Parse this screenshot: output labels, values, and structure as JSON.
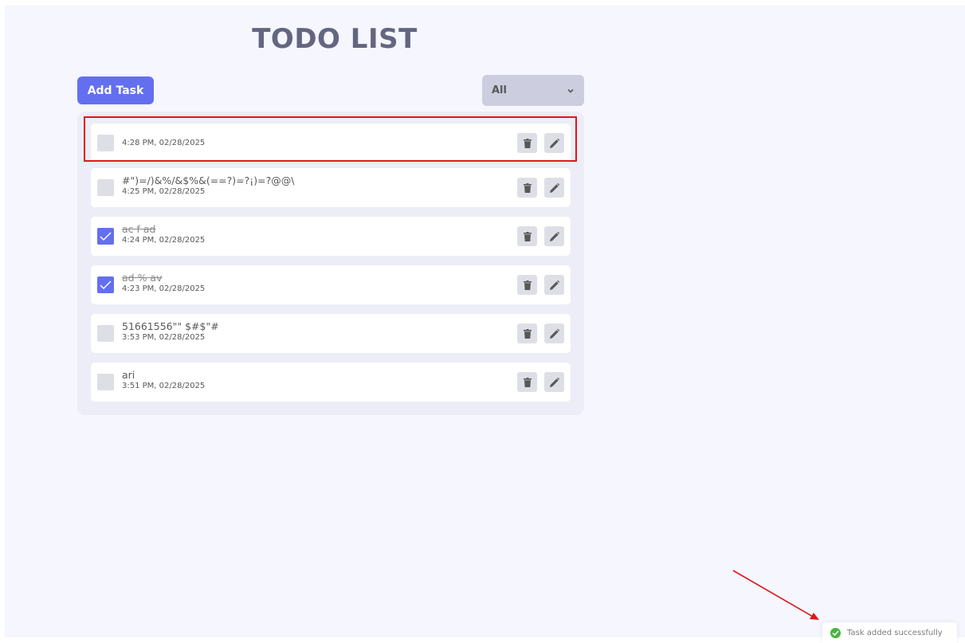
{
  "app": {
    "title": "TODO LIST"
  },
  "toolbar": {
    "add_label": "Add Task",
    "filter_selected": "All"
  },
  "tasks": [
    {
      "title": "",
      "time": "4:28 PM, 02/28/2025",
      "completed": false
    },
    {
      "title": "#\")=/)&%/&$%&(==?)=?¡)=?@@\\",
      "time": "4:25 PM, 02/28/2025",
      "completed": false
    },
    {
      "title": "ac f ad",
      "time": "4:24 PM, 02/28/2025",
      "completed": true
    },
    {
      "title": "ad % av",
      "time": "4:23 PM, 02/28/2025",
      "completed": true
    },
    {
      "title": "51661556\"\" $#$\"#",
      "time": "3:53 PM, 02/28/2025",
      "completed": false
    },
    {
      "title": "ari",
      "time": "3:51 PM, 02/28/2025",
      "completed": false
    }
  ],
  "toast": {
    "message": "Task added successfully"
  },
  "icons": {
    "delete": "trash-icon",
    "edit": "pencil-icon",
    "check": "checkmark-icon",
    "success": "check-circle-icon"
  },
  "colors": {
    "accent": "#646ff0",
    "background": "#f5f6fe",
    "annotation": "#e0161b",
    "success": "#4bb543"
  }
}
